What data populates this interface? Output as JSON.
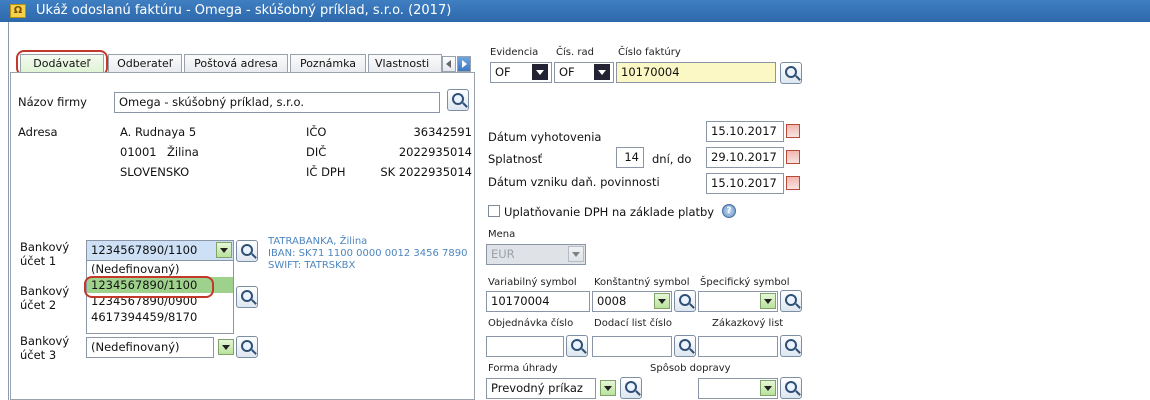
{
  "window": {
    "title": "Ukáž odoslanú faktúru - Omega - skúšobný príklad, s.r.o. (2017)"
  },
  "tabs": [
    "Dodávateľ",
    "Odberateľ",
    "Poštová adresa",
    "Poznámka",
    "Vlastnosti"
  ],
  "supplier": {
    "company_label": "Názov firmy",
    "company_value": "Omega - skúšobný príklad, s.r.o.",
    "address_label": "Adresa",
    "street": "A. Rudnaya 5",
    "zip": "01001",
    "city": "Žilina",
    "country": "SLOVENSKO",
    "ico_label": "IČO",
    "ico_value": "36342591",
    "dic_label": "DIČ",
    "dic_value": "2022935014",
    "icdph_label": "IČ DPH",
    "icdph_value": "SK 2022935014"
  },
  "bank": {
    "label1_a": "Bankový",
    "label1_b": "účet 1",
    "label2_a": "Bankový",
    "label2_b": "účet 2",
    "label3_a": "Bankový",
    "label3_b": "účet 3",
    "account1_value": "1234567890/1100",
    "account3_value": "(Nedefinovaný)",
    "options": [
      "(Nedefinovaný)",
      "1234567890/1100",
      "1234567890/0900",
      "4617394459/8170"
    ],
    "info_bank": "TATRABANKA, Žilina",
    "info_iban": "IBAN: SK71 1100 0000 0012 3456 7890",
    "info_swift": "SWIFT: TATRSKBX"
  },
  "header": {
    "evidencia_label": "Evidencia",
    "evidencia_value": "OF",
    "cisrad_label": "Čís. rad",
    "cisrad_value": "OF",
    "cislo_label": "Číslo faktúry",
    "cislo_value": "10170004"
  },
  "dates": {
    "vyhotovenie_label": "Dátum vyhotovenia",
    "vyhotovenie_value": "15.10.2017",
    "splatnost_label": "Splatnosť",
    "splatnost_days": "14",
    "splatnost_mid": "dní, do",
    "splatnost_value": "29.10.2017",
    "vznik_label": "Dátum vzniku daň. povinnosti",
    "vznik_value": "15.10.2017"
  },
  "vat_basis_label": "Uplatňovanie DPH na základe platby",
  "currency": {
    "label": "Mena",
    "value": "EUR"
  },
  "symbols": {
    "var_label": "Variabilný symbol",
    "var_value": "10170004",
    "konst_label": "Konštantný symbol",
    "konst_value": "0008",
    "spec_label": "Špecifický symbol",
    "spec_value": ""
  },
  "orders": {
    "objednavka_label": "Objednávka číslo",
    "dodaci_label": "Dodací list číslo",
    "zakazkovy_label": "Zákazkový list"
  },
  "payment": {
    "forma_label": "Forma úhrady",
    "forma_value": "Prevodný príkaz",
    "doprava_label": "Spôsob dopravy"
  }
}
